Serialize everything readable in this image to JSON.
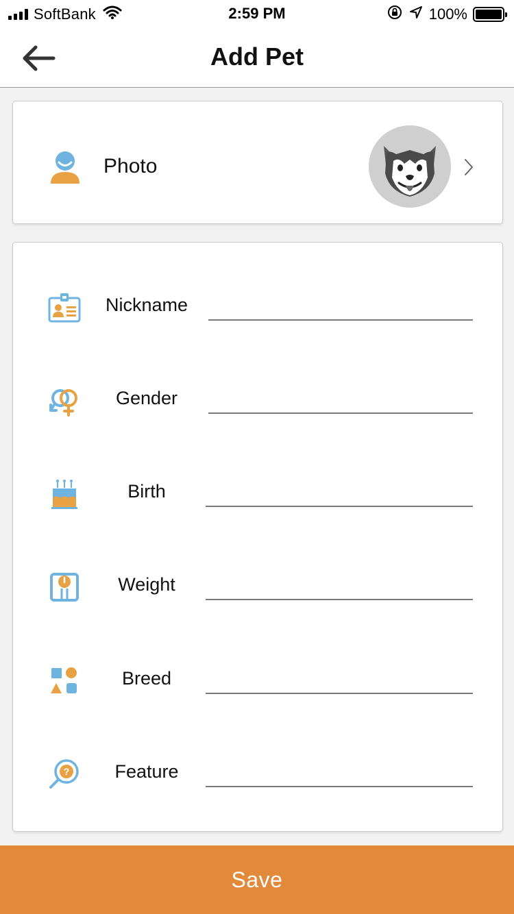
{
  "status_bar": {
    "carrier": "SoftBank",
    "time": "2:59 PM",
    "battery_percent": "100%"
  },
  "header": {
    "title": "Add Pet",
    "back_icon": "back-arrow-icon"
  },
  "photo": {
    "label": "Photo",
    "icon": "person-icon",
    "avatar": "dog-avatar",
    "chevron_icon": "chevron-right-icon"
  },
  "fields": [
    {
      "label": "Nickname",
      "icon": "id-card-icon",
      "value": ""
    },
    {
      "label": "Gender",
      "icon": "gender-icon",
      "value": ""
    },
    {
      "label": "Birth",
      "icon": "birthday-cake-icon",
      "value": ""
    },
    {
      "label": "Weight",
      "icon": "scale-icon",
      "value": ""
    },
    {
      "label": "Breed",
      "icon": "shapes-icon",
      "value": ""
    },
    {
      "label": "Feature",
      "icon": "search-question-icon",
      "value": ""
    }
  ],
  "save_button": {
    "label": "Save"
  },
  "colors": {
    "accent_orange": "#e2893a",
    "icon_orange": "#e8a243",
    "icon_blue": "#6fb3e0",
    "background": "#f2f2f2"
  }
}
